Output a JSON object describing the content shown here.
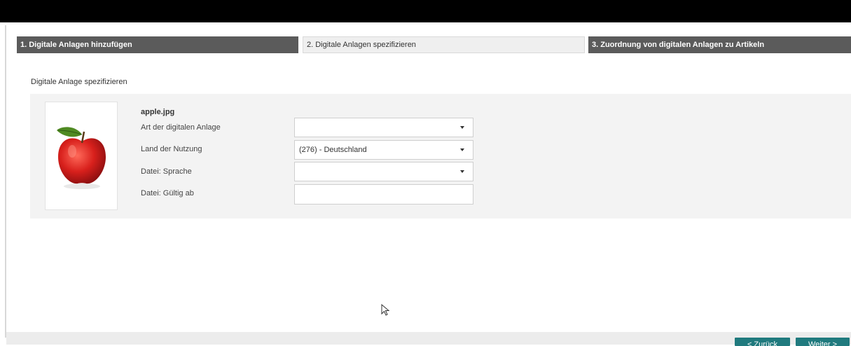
{
  "steps": [
    {
      "label": "1. Digitale Anlagen hinzufügen"
    },
    {
      "label": "2. Digitale Anlagen spezifizieren"
    },
    {
      "label": "3. Zuordnung von digitalen Anlagen zu Artikeln"
    }
  ],
  "section": {
    "title": "Digitale Anlage spezifizieren"
  },
  "asset": {
    "filename": "apple.jpg",
    "fields": [
      {
        "label": "Art der digitalen Anlage",
        "value": ""
      },
      {
        "label": "Land der Nutzung",
        "value": "(276) - Deutschland"
      },
      {
        "label": "Datei: Sprache",
        "value": ""
      },
      {
        "label": "Datei: Gültig ab",
        "value": ""
      }
    ]
  },
  "footer": {
    "back_label": "< Zurück",
    "next_label": "Weiter >"
  },
  "colors": {
    "active_step": "#5b5b5b",
    "current_step": "#efefef",
    "button": "#207a7e"
  }
}
